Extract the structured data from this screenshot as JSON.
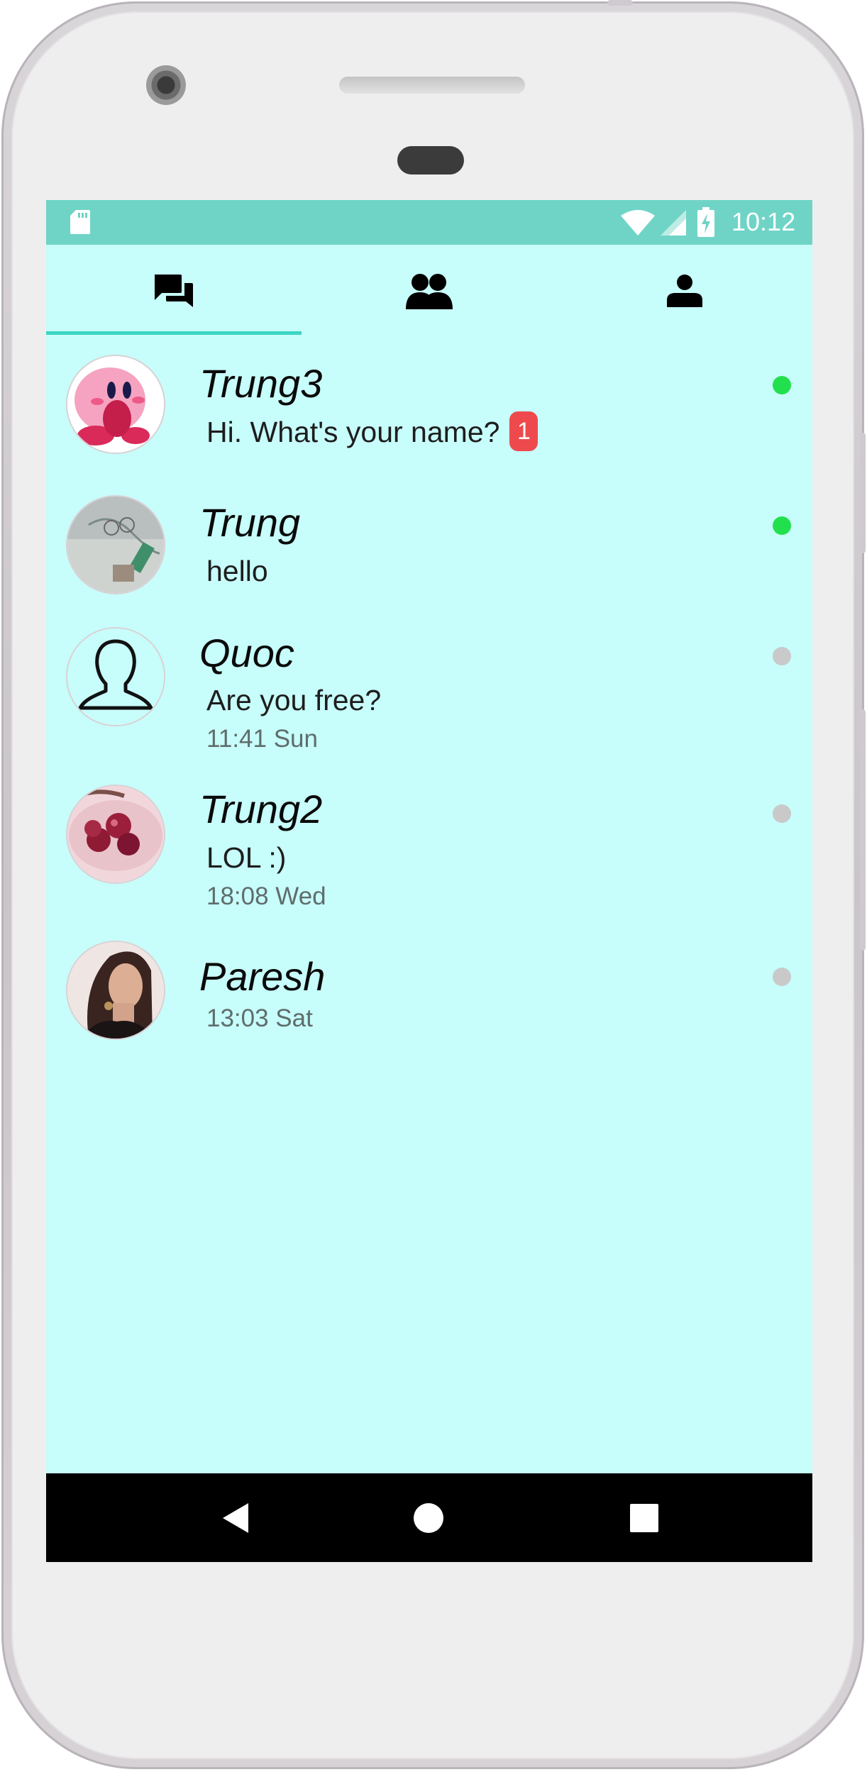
{
  "status_bar": {
    "time": "10:12",
    "icons": [
      "sd-card-icon",
      "wifi-icon",
      "cell-signal-icon",
      "battery-charging-icon"
    ]
  },
  "tabs": [
    {
      "icon": "chats-icon",
      "selected": true
    },
    {
      "icon": "friends-icon",
      "selected": false
    },
    {
      "icon": "profile-icon",
      "selected": false
    }
  ],
  "colors": {
    "status_bar": "#6fd4c6",
    "background": "#c7fdfa",
    "tab_indicator": "#3bd6c3",
    "online": "#22e04d",
    "offline": "#c9c9c9",
    "badge": "#ee4a4d"
  },
  "chats": [
    {
      "name": "Trung3",
      "message": "Hi. What's your name?",
      "unread": "1",
      "time": "",
      "online": true,
      "avatar": "kirby-avatar"
    },
    {
      "name": "Trung",
      "message": "hello",
      "unread": "",
      "time": "",
      "online": true,
      "avatar": "photo-avatar"
    },
    {
      "name": "Quoc",
      "message": "Are you free?",
      "unread": "",
      "time": "11:41 Sun",
      "online": false,
      "avatar": "default-person-avatar"
    },
    {
      "name": "Trung2",
      "message": "LOL :)",
      "unread": "",
      "time": "18:08 Wed",
      "online": false,
      "avatar": "fruit-photo-avatar"
    },
    {
      "name": "Paresh",
      "message": "",
      "unread": "",
      "time": "13:03 Sat",
      "online": false,
      "avatar": "portrait-photo-avatar"
    }
  ],
  "navigation": {
    "buttons": [
      "back-icon",
      "home-icon",
      "recents-icon"
    ]
  }
}
